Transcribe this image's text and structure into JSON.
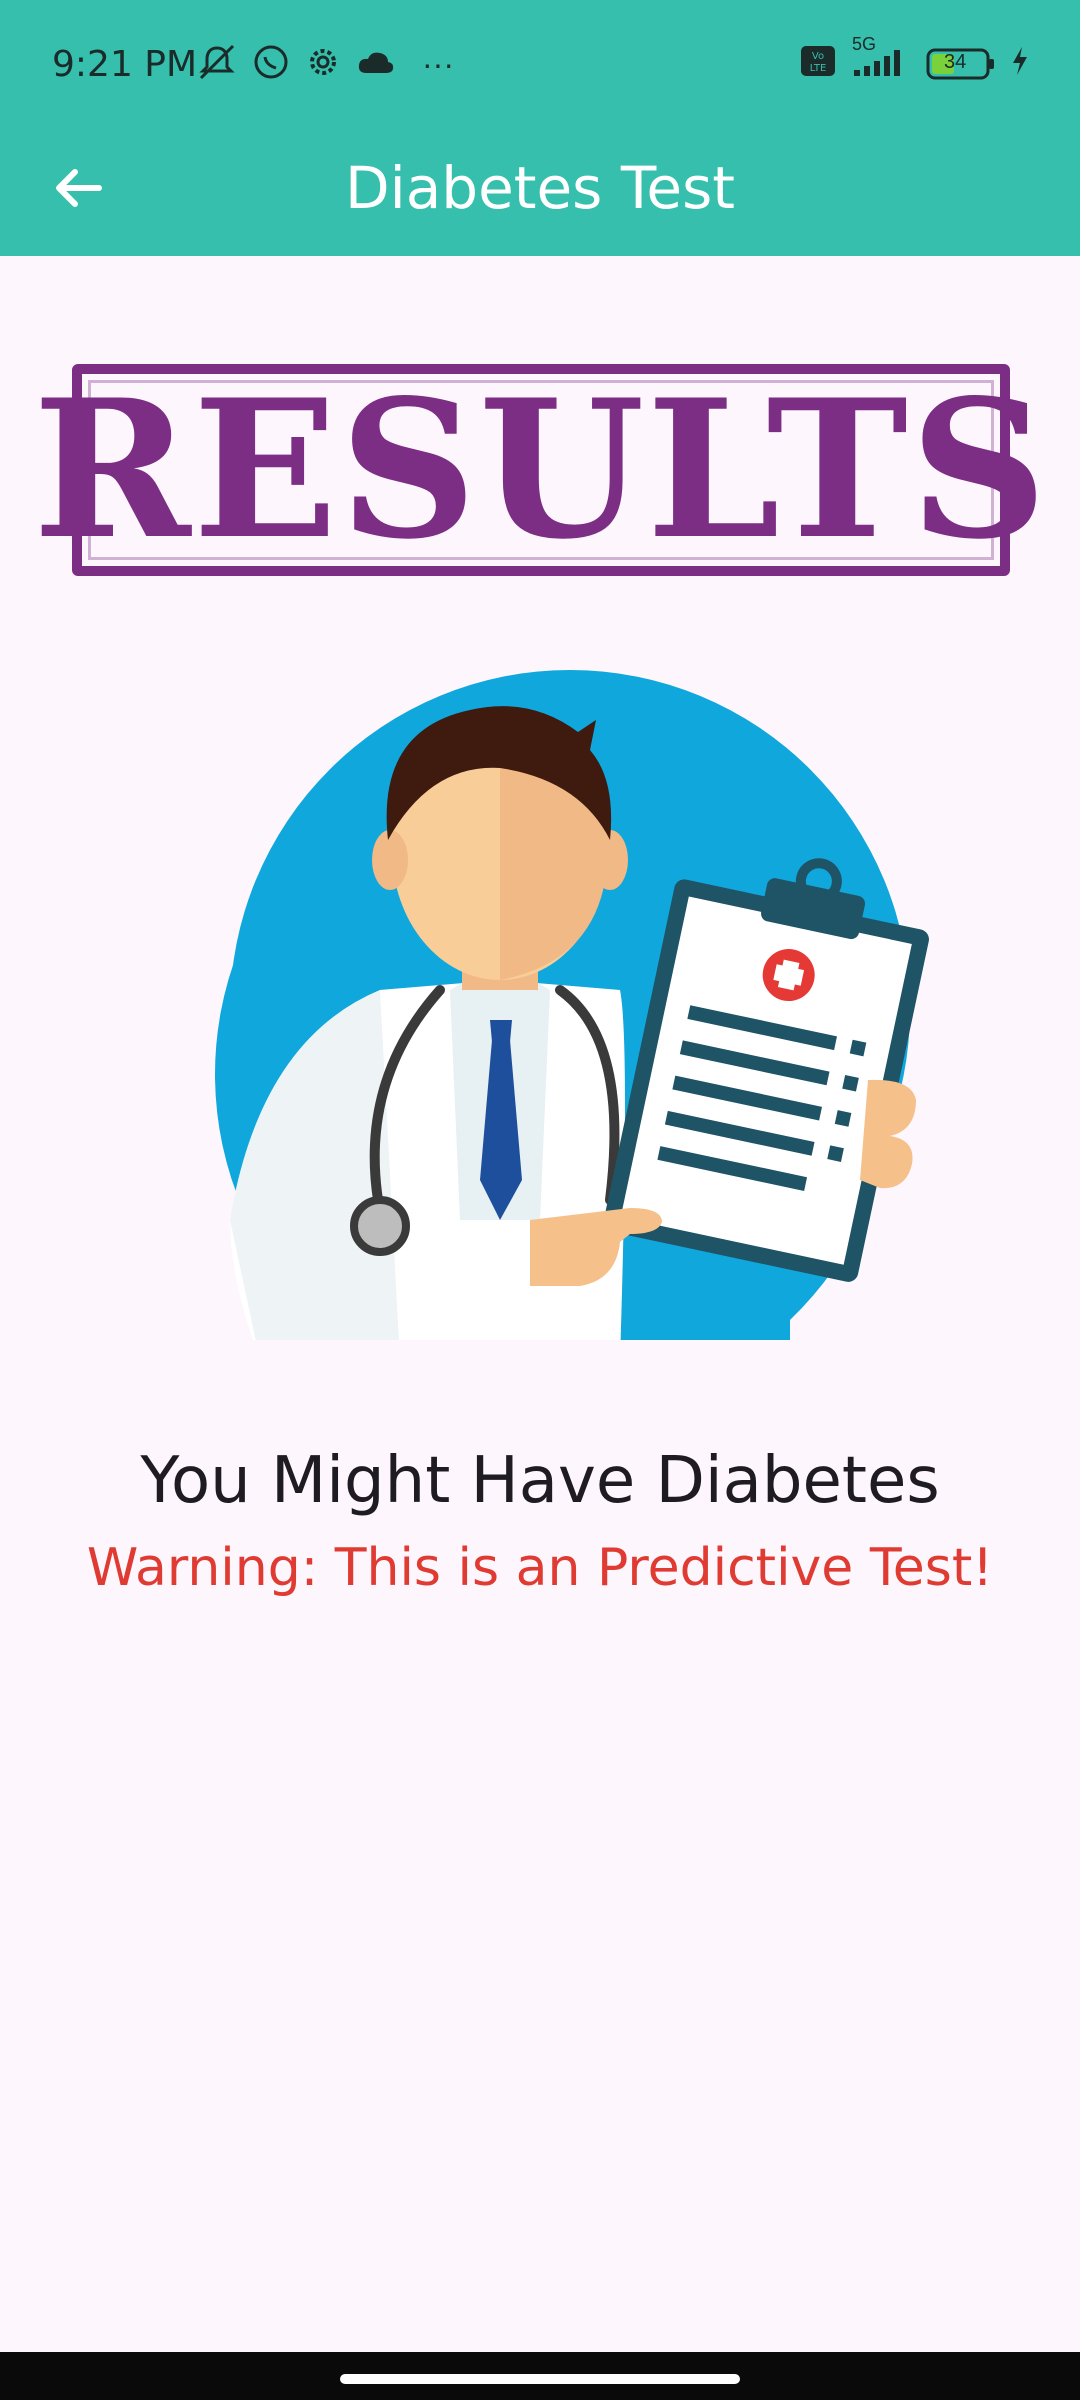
{
  "status_bar": {
    "time": "9:21 PM",
    "network": "5G",
    "battery": "34",
    "overflow": "···",
    "icons_left": [
      "mute-icon",
      "whatsapp-icon",
      "settings-gear-icon",
      "cloud-icon",
      "more-dots-icon"
    ],
    "icons_right": [
      "volte-icon",
      "signal-icon",
      "battery-icon",
      "charging-icon"
    ]
  },
  "app_bar": {
    "title": "Diabetes Test",
    "back_icon": "arrow-left-icon"
  },
  "banner": {
    "text": "RESULTS"
  },
  "illustration": {
    "name": "doctor-with-clipboard"
  },
  "result": {
    "title": "You Might Have Diabetes",
    "warning": "Warning: This is an Predictive Test!"
  },
  "colors": {
    "primary": "#35bfac",
    "banner": "#7b2e84",
    "warning": "#e03b32",
    "background": "#fdf6fd",
    "illustration_circle": "#10a7dc"
  }
}
